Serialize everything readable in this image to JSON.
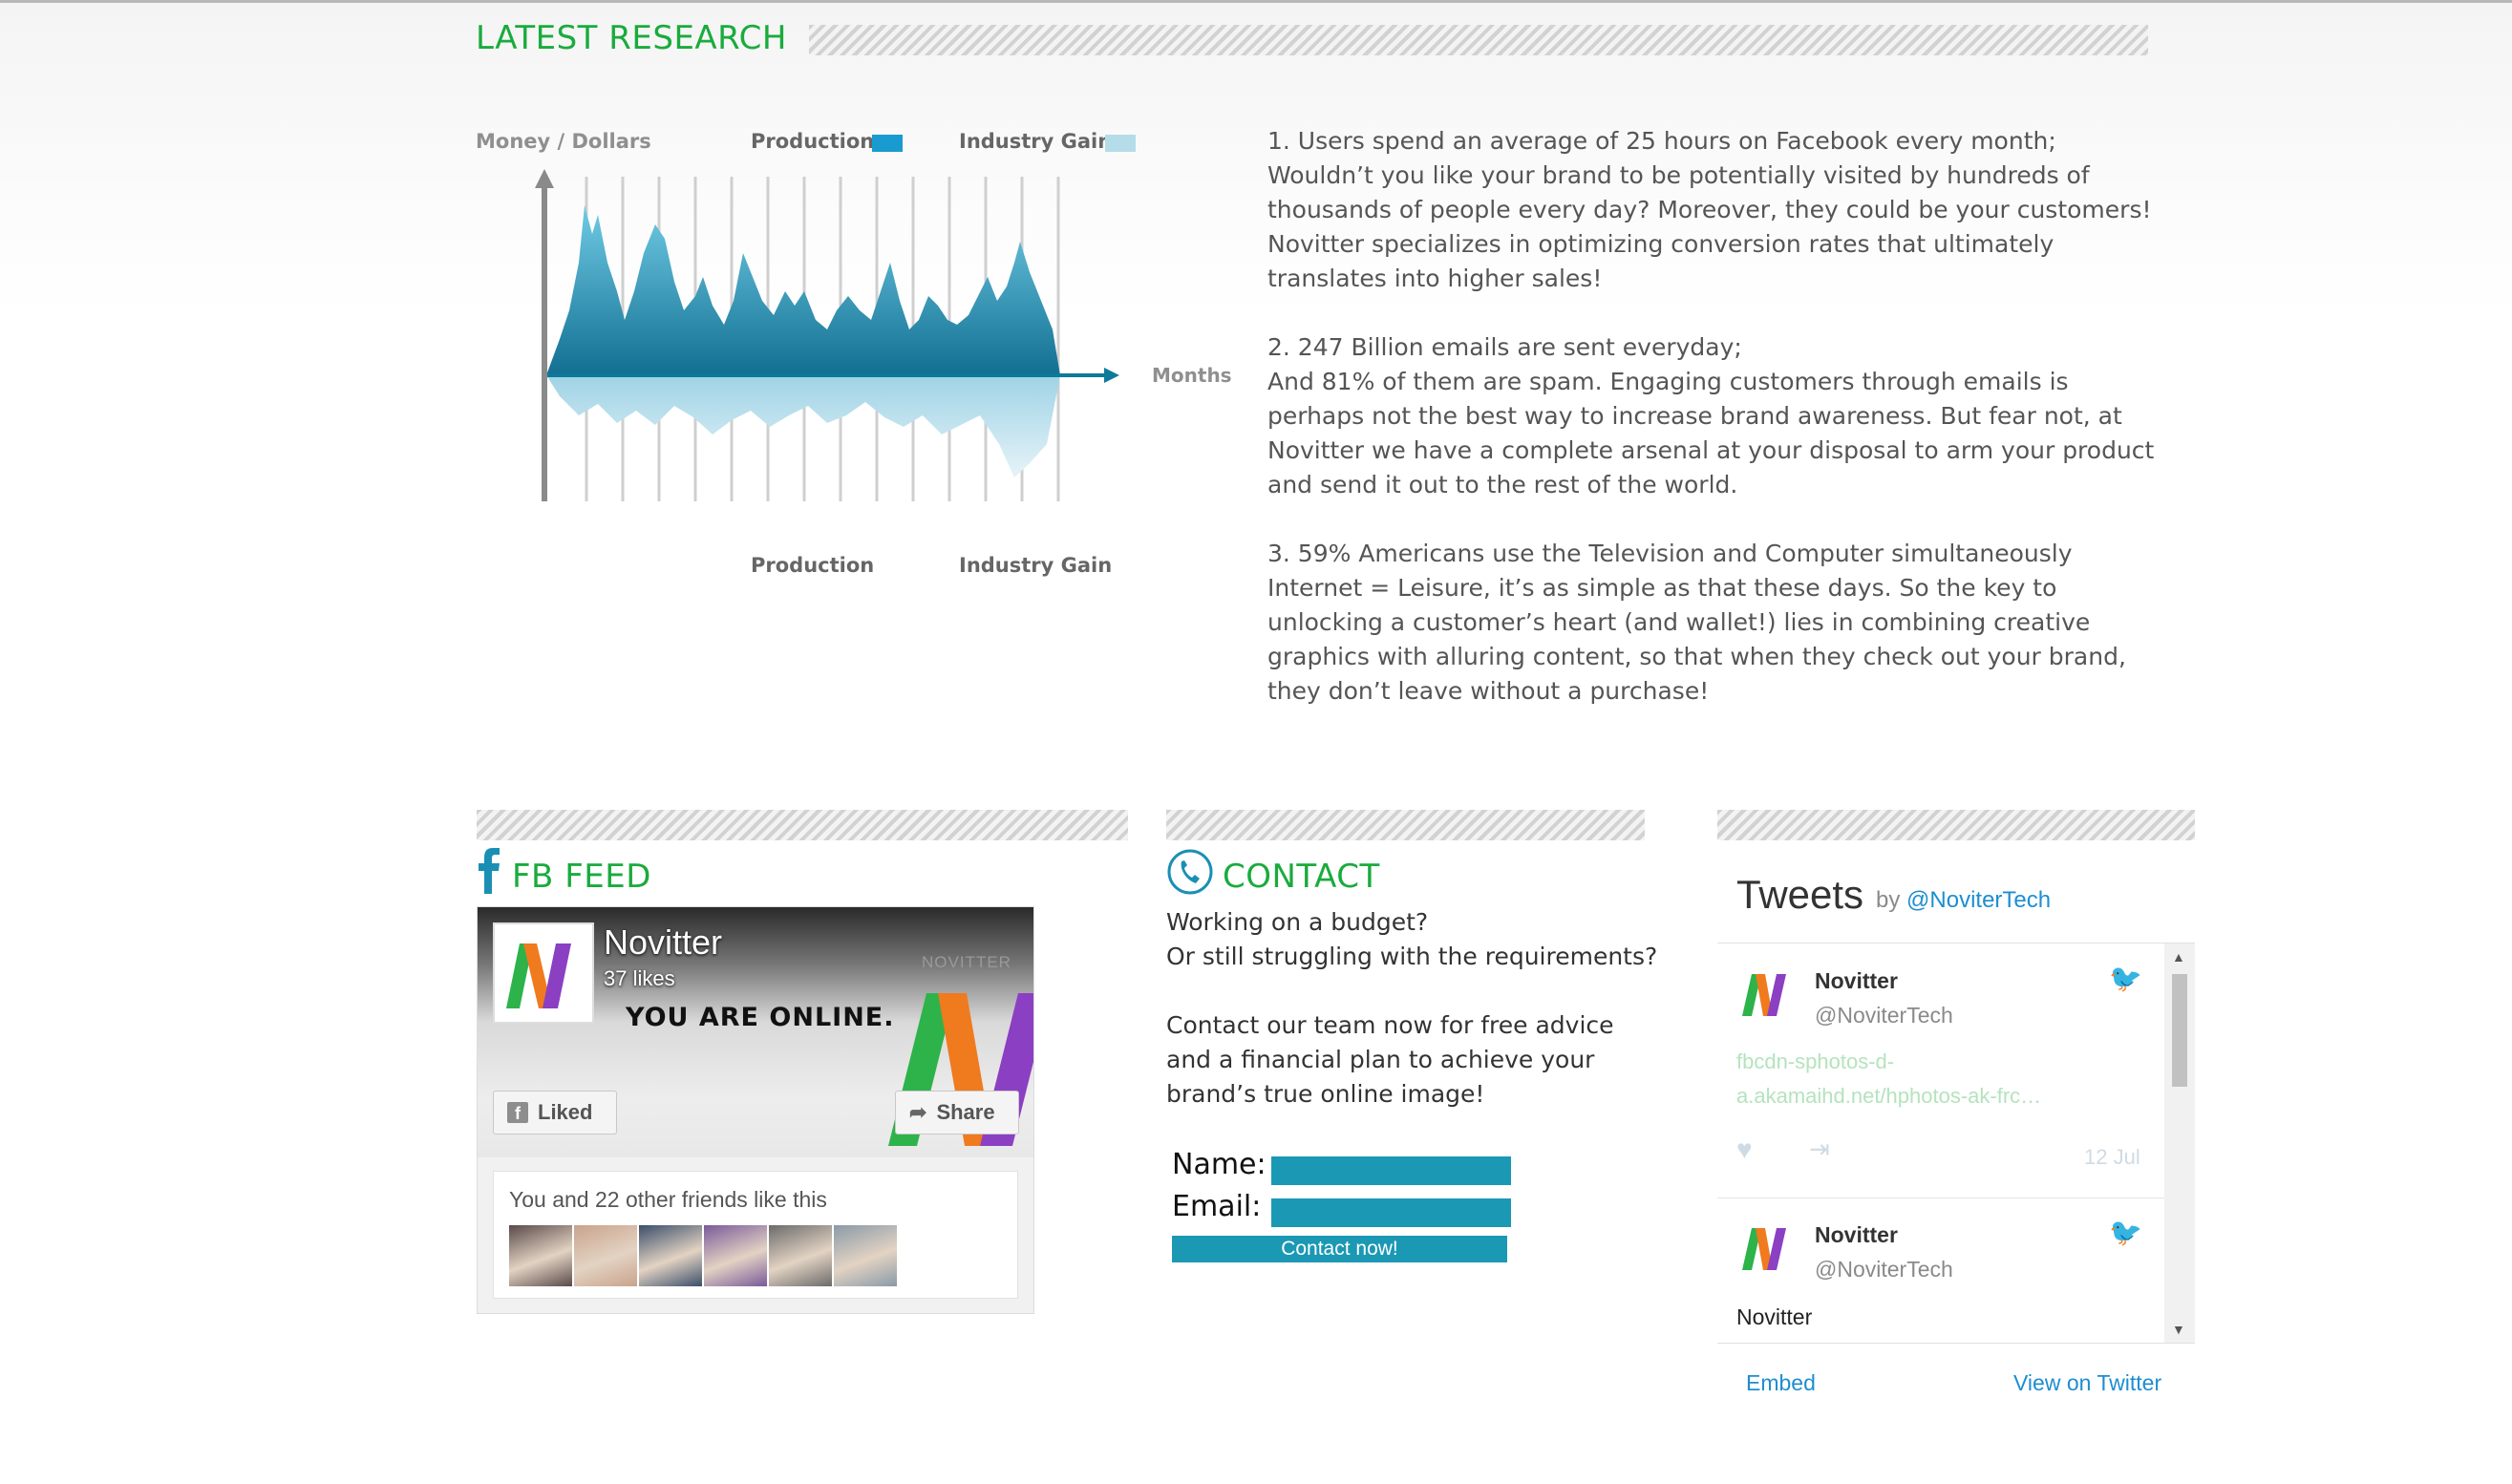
{
  "research": {
    "title": "LATEST RESEARCH",
    "chart": {
      "y_label": "Money / Dollars",
      "x_label": "Months",
      "legend_top": [
        {
          "label": "Production",
          "color": "#1a9bd0"
        },
        {
          "label": "Industry Gain",
          "color": "#b5dce9"
        }
      ],
      "legend_bottom": [
        "Production",
        "Industry Gain"
      ]
    },
    "items": [
      {
        "head": "1.   Users spend an average of 25 hours on Facebook every month;",
        "body": "Wouldn’t you like your brand to be potentially visited by hundreds of thousands of people every day? Moreover, they could be your customers! Novitter specializes in optimizing conversion rates that ultimately translates into higher sales!"
      },
      {
        "head": "2.   247 Billion emails are sent everyday;",
        "body": "And 81% of them are spam. Engaging customers through emails is perhaps not the best way to increase brand awareness. But fear not, at Novitter we have a complete arsenal at your disposal to arm your product and send it out to the rest of the world."
      },
      {
        "head": "3.   59% Americans use the Television and Computer simultaneously",
        "body": "Internet = Leisure, it’s as simple as that these days. So the key to unlocking a customer’s heart (and wallet!) lies in combining creative graphics with alluring content, so that when they check out your brand, they don’t leave without a purchase!"
      }
    ]
  },
  "fb": {
    "title": "FB FEED",
    "page_name": "Novitter",
    "likes": "37 likes",
    "tagline": "YOU ARE ONLINE.",
    "brand": "NOVITTER",
    "liked_label": "Liked",
    "share_label": "Share",
    "friends_text": "You and 22 other friends like this",
    "avatar_colors": [
      "#5a4a4a",
      "#c9a38c",
      "#3a4f6a",
      "#7a5a9a",
      "#6b6b6b",
      "#8a9aa8"
    ]
  },
  "contact": {
    "title": "CONTACT",
    "line1": "Working on a budget?",
    "line2": "Or still struggling with the requirements?",
    "para2": "Contact our team now for free advice and a financial plan to achieve your brand’s true online image!",
    "name_label": "Name:",
    "email_label": "Email:",
    "name_value": "",
    "email_value": "",
    "submit_label": "Contact now!"
  },
  "twitter": {
    "title": "Tweets",
    "by": "by",
    "handle": "@NoviterTech",
    "tweets": [
      {
        "name": "Novitter",
        "user": "@NoviterTech",
        "link": "fbcdn-sphotos-d-a.akamaihd.net/hphotos-ak-frc…",
        "date": "12 Jul"
      },
      {
        "name": "Novitter",
        "user": "@NoviterTech",
        "text": "Novitter"
      }
    ],
    "embed_label": "Embed",
    "view_label": "View on Twitter"
  }
}
